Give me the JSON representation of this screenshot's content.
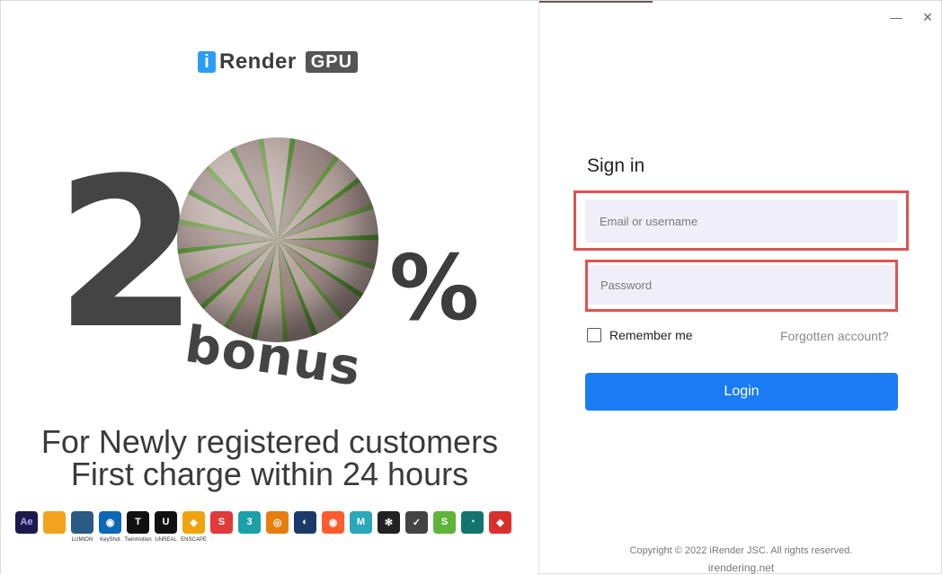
{
  "window": {
    "minimize_icon": "—",
    "close_icon": "✕"
  },
  "promo": {
    "logo": {
      "i": "i",
      "word": "Render",
      "gpu": "GPU"
    },
    "big_number": "2",
    "percent": "%",
    "bonus": "bonus",
    "tagline_1": "For Newly registered customers",
    "tagline_2": "First charge within 24 hours",
    "apps": [
      {
        "name": "after-effects",
        "label": "Ae",
        "caption": "",
        "color": "#1e1a4d",
        "fg": "#b9a7ff"
      },
      {
        "name": "lumion-bird",
        "label": "",
        "caption": "",
        "color": "#f2a21b",
        "fg": "#fff"
      },
      {
        "name": "lumion",
        "label": "",
        "caption": "LUMION",
        "color": "#2a5a86",
        "fg": "#fff"
      },
      {
        "name": "keyshot",
        "label": "◉",
        "caption": "KeyShot",
        "color": "#0d67b5",
        "fg": "#fff"
      },
      {
        "name": "twinmotion",
        "label": "T",
        "caption": "Twinmotion",
        "color": "#111111",
        "fg": "#fff"
      },
      {
        "name": "unreal-engine",
        "label": "U",
        "caption": "UNREAL",
        "color": "#111111",
        "fg": "#fff"
      },
      {
        "name": "enscape",
        "label": "◆",
        "caption": "ENSCAPE",
        "color": "#f1a30e",
        "fg": "#fff"
      },
      {
        "name": "sketchup",
        "label": "S",
        "caption": "",
        "color": "#e03a3a",
        "fg": "#fff"
      },
      {
        "name": "3ds-max",
        "label": "3",
        "caption": "",
        "color": "#1aa0a6",
        "fg": "#fff"
      },
      {
        "name": "blender",
        "label": "◎",
        "caption": "",
        "color": "#e87d0d",
        "fg": "#fff"
      },
      {
        "name": "cinema-4d",
        "label": "◐",
        "caption": "",
        "color": "#1b3a6b",
        "fg": "#fff"
      },
      {
        "name": "houdini",
        "label": "◉",
        "caption": "",
        "color": "#ff5b2b",
        "fg": "#fff"
      },
      {
        "name": "maya",
        "label": "M",
        "caption": "",
        "color": "#2aa7b8",
        "fg": "#fff"
      },
      {
        "name": "octane",
        "label": "✻",
        "caption": "",
        "color": "#222222",
        "fg": "#fff"
      },
      {
        "name": "vray",
        "label": "✓",
        "caption": "",
        "color": "#444444",
        "fg": "#fff"
      },
      {
        "name": "substance",
        "label": "S",
        "caption": "",
        "color": "#5fb43a",
        "fg": "#fff"
      },
      {
        "name": "corona",
        "label": "◔",
        "caption": "",
        "color": "#12746d",
        "fg": "#fff"
      },
      {
        "name": "redshift",
        "label": "◆",
        "caption": "",
        "color": "#d9302c",
        "fg": "#fff"
      }
    ]
  },
  "login": {
    "title": "Sign in",
    "email_placeholder": "Email or username",
    "password_placeholder": "Password",
    "remember_label": "Remember me",
    "forgot_label": "Forgotten account?",
    "login_button": "Login",
    "copyright": "Copyright © 2022 iRender JSC. All rights reserved.",
    "site": "irendering.net"
  },
  "colors": {
    "accent": "#1a7cf5",
    "highlight": "#e05252",
    "input_bg": "#f0eff7"
  }
}
